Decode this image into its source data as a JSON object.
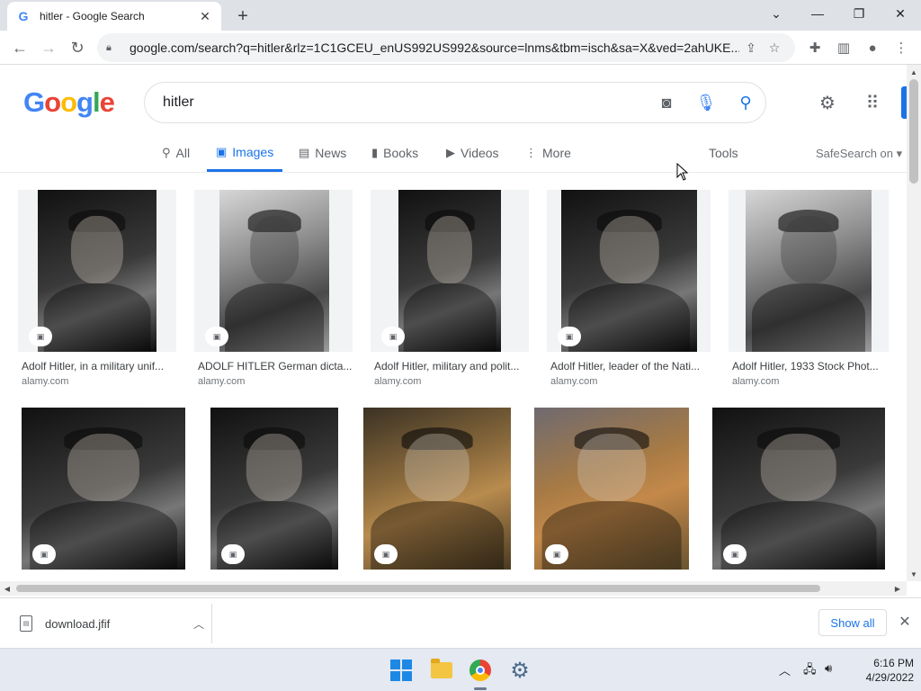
{
  "browser": {
    "tab_title": "hitler - Google Search",
    "tab_favicon": "G",
    "url": "google.com/search?q=hitler&rlz=1C1GCEU_enUS992US992&source=lnms&tbm=isch&sa=X&ved=2ahUKE...",
    "window_controls": {
      "dropdown": "⌄",
      "minimize": "—",
      "restore": "❐",
      "close": "✕"
    }
  },
  "google": {
    "logo_letters": [
      "G",
      "o",
      "o",
      "g",
      "l",
      "e"
    ],
    "query": "hitler"
  },
  "nav_tabs": [
    {
      "label": "All",
      "icon": "search-icon",
      "glyph": "⚲",
      "active": false
    },
    {
      "label": "Images",
      "icon": "image-icon",
      "glyph": "▣",
      "active": true
    },
    {
      "label": "News",
      "icon": "news-icon",
      "glyph": "▤",
      "active": false
    },
    {
      "label": "Books",
      "icon": "book-icon",
      "glyph": "▮",
      "active": false
    },
    {
      "label": "Videos",
      "icon": "video-icon",
      "glyph": "▶",
      "active": false
    },
    {
      "label": "More",
      "icon": "more-icon",
      "glyph": "⋮",
      "active": false
    }
  ],
  "tools_label": "Tools",
  "safesearch_label": "SafeSearch on ▾",
  "results": [
    {
      "caption": "Adolf Hitler, in a military unif...",
      "source": "alamy.com",
      "tone": "dark"
    },
    {
      "caption": "ADOLF HITLER German dicta...",
      "source": "alamy.com",
      "tone": "light"
    },
    {
      "caption": "Adolf Hitler, military and polit...",
      "source": "alamy.com",
      "tone": "dark"
    },
    {
      "caption": "Adolf Hitler, leader of the Nati...",
      "source": "alamy.com",
      "tone": "dark"
    },
    {
      "caption": "Adolf Hitler, 1933 Stock Phot...",
      "source": "alamy.com",
      "tone": "light"
    },
    {
      "caption": "",
      "source": "",
      "tone": "dark"
    },
    {
      "caption": "",
      "source": "",
      "tone": "dark"
    },
    {
      "caption": "",
      "source": "",
      "tone": "sepia"
    },
    {
      "caption": "",
      "source": "",
      "tone": "sepia2"
    },
    {
      "caption": "",
      "source": "",
      "tone": "dark"
    }
  ],
  "download": {
    "filename": "download.jfif",
    "show_all": "Show all"
  },
  "taskbar": {
    "time": "6:16 PM",
    "date": "4/29/2022"
  },
  "colors": {
    "accent": "#1a73e8",
    "tab_strip": "#dee1e6",
    "taskbar": "#e4e9f2"
  }
}
